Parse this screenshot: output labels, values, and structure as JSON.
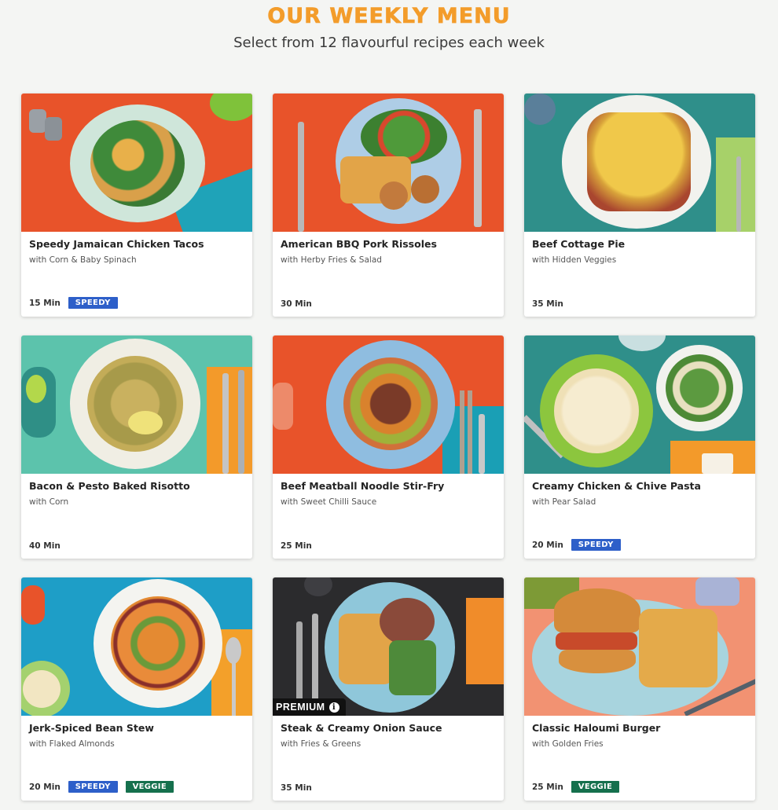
{
  "header": {
    "title": "OUR WEEKLY MENU",
    "subtitle": "Select from 12 flavourful recipes each week"
  },
  "colors": {
    "title": "#f39c2a",
    "speedy_tag": "#2d5fc9",
    "veggie_tag": "#15704d",
    "premium_badge": "#111111"
  },
  "recipes": [
    {
      "name": "Speedy Jamaican Chicken Tacos",
      "sub": "with Corn & Baby Spinach",
      "time": "15 Min",
      "tags": [
        "SPEEDY"
      ],
      "premium": ""
    },
    {
      "name": "American BBQ Pork Rissoles",
      "sub": "with Herby Fries & Salad",
      "time": "30 Min",
      "tags": [],
      "premium": ""
    },
    {
      "name": "Beef Cottage Pie",
      "sub": "with Hidden Veggies",
      "time": "35 Min",
      "tags": [],
      "premium": ""
    },
    {
      "name": "Bacon & Pesto Baked Risotto",
      "sub": "with Corn",
      "time": "40 Min",
      "tags": [],
      "premium": ""
    },
    {
      "name": "Beef Meatball Noodle Stir-Fry",
      "sub": "with Sweet Chilli Sauce",
      "time": "25 Min",
      "tags": [],
      "premium": ""
    },
    {
      "name": "Creamy Chicken & Chive Pasta",
      "sub": "with Pear Salad",
      "time": "20 Min",
      "tags": [
        "SPEEDY"
      ],
      "premium": ""
    },
    {
      "name": "Jerk-Spiced Bean Stew",
      "sub": "with Flaked Almonds",
      "time": "20 Min",
      "tags": [
        "SPEEDY",
        "VEGGIE"
      ],
      "premium": ""
    },
    {
      "name": "Steak & Creamy Onion Sauce",
      "sub": "with Fries & Greens",
      "time": "35 Min",
      "tags": [],
      "premium": "PREMIUM"
    },
    {
      "name": "Classic Haloumi Burger",
      "sub": "with Golden Fries",
      "time": "25 Min",
      "tags": [
        "VEGGIE"
      ],
      "premium": ""
    }
  ]
}
